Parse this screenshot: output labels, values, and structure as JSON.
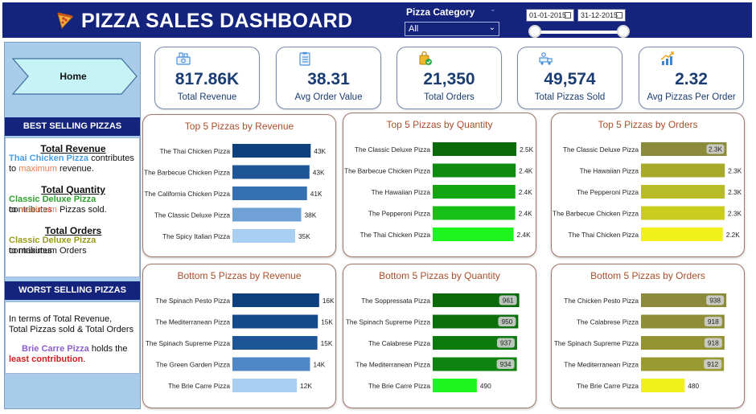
{
  "header": {
    "title": "PIZZA SALES DASHBOARD",
    "filter_label": "Pizza Category",
    "filter_value": "All",
    "date_start": "01-01-2015",
    "date_end": "31-12-2015"
  },
  "sidebar": {
    "home_label": "Home",
    "best_heading": "BEST SELLING PIZZAS",
    "best": {
      "rev_title": "Total Revenue",
      "rev_pizza": "Thai Chicken Pizza",
      "rev_l1": "contributes",
      "rev_to": "to",
      "rev_max": "maximum",
      "rev_end": "revenue.",
      "qty_title": "Total Quantity",
      "qty_pizza": "Classic Deluxe Pizza",
      "qty_l1": "contributes",
      "qty_to": "to",
      "qty_max": "maximum",
      "qty_end": "Pizzas sold.",
      "ord_title": "Total Orders",
      "ord_pizza": "Classic Deluxe Pizza",
      "ord_l1": "contributes",
      "ord_end": "to maximum Orders"
    },
    "worst_heading": "WORST SELLING PIZZAS",
    "worst": {
      "line1": "In terms of Total Revenue,",
      "line2": "Total Pizzas sold & Total Orders",
      "pizza": "Brie Carre Pizza",
      "holds": "holds the",
      "least": "least contribution",
      "dot": "."
    }
  },
  "kpis": [
    {
      "value": "817.86K",
      "label": "Total Revenue",
      "icon": "money-icon"
    },
    {
      "value": "38.31",
      "label": "Avg Order Value",
      "icon": "clipboard-icon"
    },
    {
      "value": "21,350",
      "label": "Total Orders",
      "icon": "shopping-bag-icon"
    },
    {
      "value": "49,574",
      "label": "Total Pizzas Sold",
      "icon": "delivery-icon"
    },
    {
      "value": "2.32",
      "label": "Avg Pizzas Per Order",
      "icon": "growth-chart-icon"
    }
  ],
  "colors": {
    "header_bg": "#14237c",
    "panel_bg": "#a8ccea",
    "kpi_text": "#1b3d73",
    "card_title": "#a84e2a"
  },
  "chart_data": [
    {
      "type": "bar",
      "orientation": "horizontal",
      "title": "Top 5 Pizzas by Revenue",
      "categories": [
        "The Thai Chicken Pizza",
        "The Barbecue Chicken Pizza",
        "The California Chicken Pizza",
        "The Classic Deluxe Pizza",
        "The Spicy Italian Pizza"
      ],
      "values": [
        43434,
        42768,
        41410,
        38180,
        34831
      ],
      "labels": [
        "43K",
        "43K",
        "41K",
        "38K",
        "35K"
      ],
      "colors": [
        "#0e3f7e",
        "#1e5596",
        "#3570b2",
        "#6fa1d6",
        "#a8cff2"
      ],
      "xlim": [
        0,
        50000
      ],
      "label_inside": false
    },
    {
      "type": "bar",
      "orientation": "horizontal",
      "title": "Top 5 Pizzas by Quantity",
      "categories": [
        "The Classic Deluxe Pizza",
        "The Barbecue Chicken Pizza",
        "The Hawaiian Pizza",
        "The Pepperoni Pizza",
        "The Thai Chicken Pizza"
      ],
      "values": [
        2453,
        2432,
        2422,
        2418,
        2371
      ],
      "labels": [
        "2.5K",
        "2.4K",
        "2.4K",
        "2.4K",
        "2.4K"
      ],
      "colors": [
        "#0a6a0a",
        "#0e8a0e",
        "#12a612",
        "#16c016",
        "#1ef51e"
      ],
      "xlim": [
        0,
        2640
      ],
      "label_inside": false
    },
    {
      "type": "bar",
      "orientation": "horizontal",
      "title": "Top 5 Pizzas by Orders",
      "categories": [
        "The Classic Deluxe Pizza",
        "The Hawaiian Pizza",
        "The Pepperoni Pizza",
        "The Barbecue Chicken Pizza",
        "The Thai Chicken Pizza"
      ],
      "values": [
        2329,
        2280,
        2278,
        2273,
        2225
      ],
      "labels": [
        "2.3K",
        "2.3K",
        "2.3K",
        "2.3K",
        "2.2K"
      ],
      "colors": [
        "#8a8a3a",
        "#a8ab2a",
        "#b8bc26",
        "#cacd1e",
        "#f0f01a"
      ],
      "xlim": [
        0,
        2450
      ],
      "label_inside": [
        true,
        false,
        false,
        false,
        false
      ]
    },
    {
      "type": "bar",
      "orientation": "horizontal",
      "title": "Bottom 5 Pizzas by Revenue",
      "categories": [
        "The Spinach Pesto Pizza",
        "The Mediterranean Pizza",
        "The Spinach Supreme Pizza",
        "The Green Garden Pizza",
        "The Brie Carre Pizza"
      ],
      "values": [
        15596,
        15361,
        15277,
        13956,
        11588
      ],
      "labels": [
        "16K",
        "15K",
        "15K",
        "14K",
        "12K"
      ],
      "colors": [
        "#0e3f7e",
        "#14498c",
        "#1e5596",
        "#4f87c7",
        "#a8cff2"
      ],
      "xlim": [
        0,
        16200
      ],
      "label_inside": false
    },
    {
      "type": "bar",
      "orientation": "horizontal",
      "title": "Bottom 5 Pizzas by Quantity",
      "categories": [
        "The Soppressata Pizza",
        "The Spinach Supreme Pizza",
        "The Calabrese Pizza",
        "The Mediterranean Pizza",
        "The Brie Carre Pizza"
      ],
      "values": [
        961,
        950,
        937,
        934,
        490
      ],
      "labels": [
        "961",
        "950",
        "937",
        "934",
        "490"
      ],
      "colors": [
        "#0a6a0a",
        "#0b700b",
        "#0d7a0d",
        "#0f830f",
        "#1ef51e"
      ],
      "xlim": [
        0,
        1000
      ],
      "label_inside": [
        true,
        true,
        true,
        true,
        false
      ]
    },
    {
      "type": "bar",
      "orientation": "horizontal",
      "title": "Bottom 5 Pizzas by Orders",
      "categories": [
        "The Chicken Pesto Pizza",
        "The Calabrese Pizza",
        "The Spinach Supreme Pizza",
        "The Mediterranean Pizza",
        "The Brie Carre Pizza"
      ],
      "values": [
        938,
        918,
        918,
        912,
        480
      ],
      "labels": [
        "938",
        "918",
        "918",
        "912",
        "480"
      ],
      "colors": [
        "#8a8a3a",
        "#8e8e36",
        "#939334",
        "#999a30",
        "#f0f01a"
      ],
      "xlim": [
        0,
        990
      ],
      "label_inside": [
        true,
        true,
        true,
        true,
        false
      ]
    }
  ]
}
